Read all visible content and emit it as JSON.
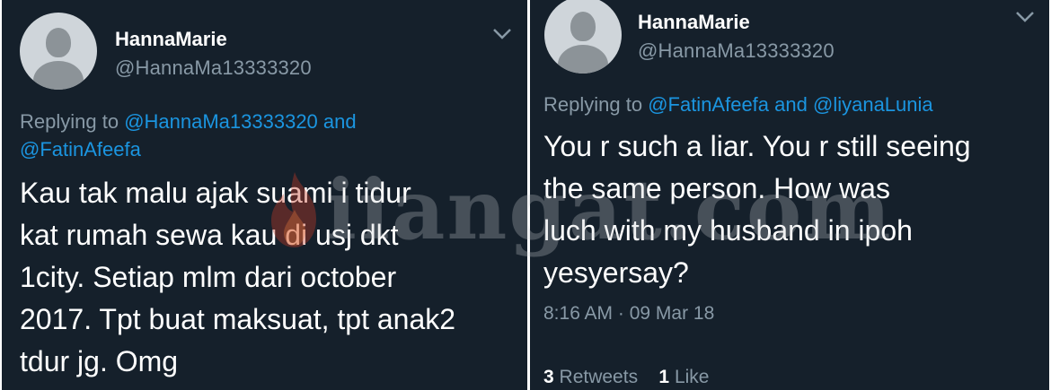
{
  "tweets": [
    {
      "name": "HannaMarie",
      "handle": "@HannaMa13333320",
      "replying_prefix": "Replying to ",
      "replying_line1": "@HannaMa13333320 and",
      "replying_line2": "@FatinAfeefa",
      "text_lines": [
        "Kau tak malu ajak suami i tidur",
        "kat rumah sewa kau di usj dkt",
        "1city. Setiap mlm dari october",
        "2017. Tpt buat maksuat, tpt anak2",
        "tdur jg. Omg"
      ]
    },
    {
      "name": "HannaMarie",
      "handle": "@HannaMa13333320",
      "replying_prefix": "Replying to ",
      "replying_user1": "@FatinAfeefa",
      "replying_and": " and ",
      "replying_user2": "@liyanaLunia",
      "text_lines": [
        "You r such a liar. You r still seeing",
        "the same person. How was",
        "luch with my husband in ipoh",
        "yesyersay?"
      ],
      "timestamp": "8:16 AM · 09 Mar 18",
      "retweets_count": "3",
      "retweets_label": "Retweets",
      "likes_count": "1",
      "likes_label": "Like"
    }
  ],
  "watermark": {
    "text": "iiangat.com"
  },
  "icons": {
    "avatar": "default-avatar-icon",
    "menu": "chevron-down-icon",
    "watermark": "flame-icon"
  },
  "colors": {
    "background": "#15202b",
    "link": "#1b95e0",
    "muted": "#8899a6",
    "text": "#ffffff"
  }
}
